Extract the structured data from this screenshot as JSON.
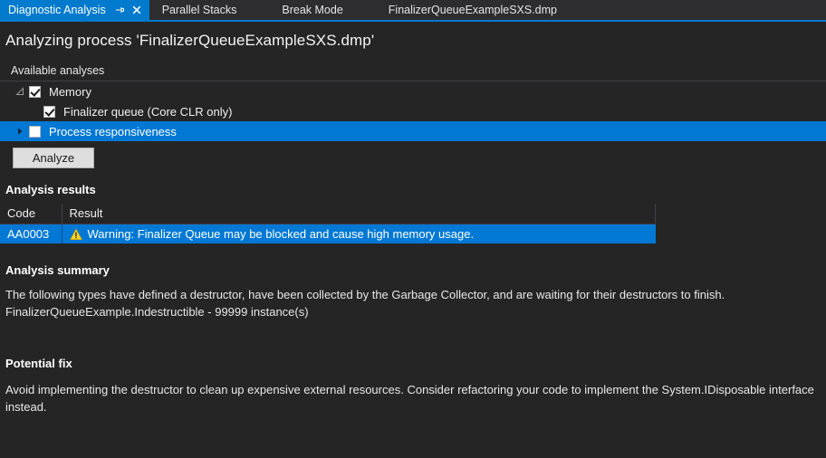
{
  "tabbar": {
    "tabs": [
      {
        "label": "Diagnostic Analysis",
        "active": true
      },
      {
        "label": "Parallel Stacks",
        "active": false
      },
      {
        "label": "Break Mode",
        "active": false
      },
      {
        "label": "FinalizerQueueExampleSXS.dmp",
        "active": false
      }
    ],
    "pin_icon": "pin-icon",
    "close_icon": "close-icon"
  },
  "page": {
    "title": "Analyzing process 'FinalizerQueueExampleSXS.dmp'"
  },
  "analyses": {
    "header": "Available analyses",
    "rows": [
      {
        "label": "Memory",
        "twisty": "expanded",
        "checked": true,
        "selected": false,
        "indent": false
      },
      {
        "label": "Finalizer queue (Core CLR only)",
        "twisty": "none",
        "checked": true,
        "selected": false,
        "indent": true
      },
      {
        "label": "Process responsiveness",
        "twisty": "collapsed",
        "checked": false,
        "selected": true,
        "indent": false
      }
    ],
    "analyze_button": "Analyze"
  },
  "results": {
    "title": "Analysis results",
    "columns": [
      "Code",
      "Result"
    ],
    "rows": [
      {
        "code": "AA0003",
        "icon": "warning-icon",
        "result": "Warning: Finalizer Queue may be blocked and cause high memory usage.",
        "selected": true
      }
    ]
  },
  "summary": {
    "title": "Analysis summary",
    "line1": "The following types have defined a destructor, have been collected by the Garbage Collector, and are waiting for their destructors to finish.",
    "line2": "FinalizerQueueExample.Indestructible - 99999 instance(s)"
  },
  "fix": {
    "title": "Potential fix",
    "body": "Avoid implementing the destructor to clean up expensive external resources. Consider refactoring your code to implement the System.IDisposable interface instead."
  },
  "colors": {
    "accent": "#007acc",
    "selection": "#0078d4",
    "background": "#252526",
    "tabbar": "#2d2d30",
    "warning": "#ffd42a"
  }
}
